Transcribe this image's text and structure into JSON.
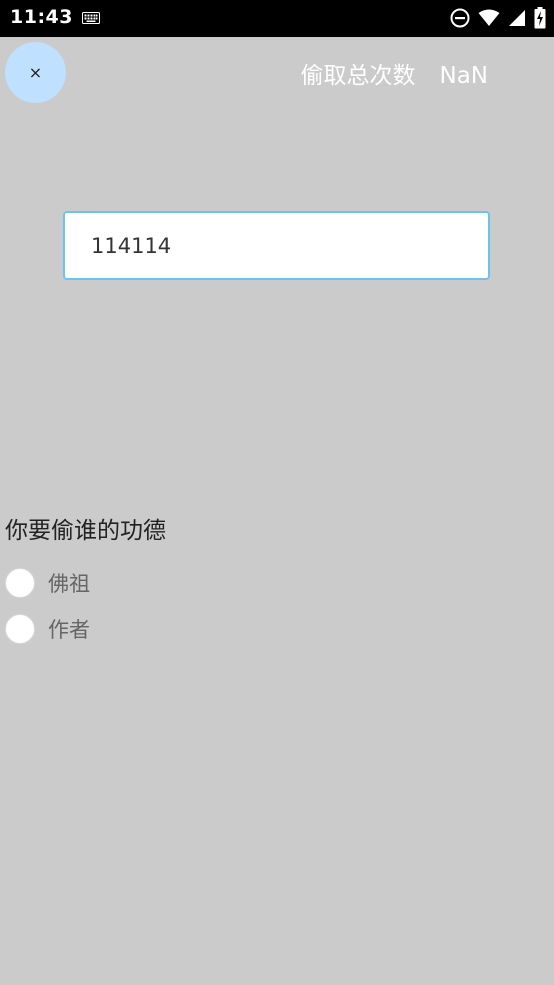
{
  "status_bar": {
    "time": "11:43",
    "icons": [
      "keyboard-icon",
      "do-not-disturb-icon",
      "wifi-icon",
      "signal-icon",
      "battery-charging-icon"
    ]
  },
  "close_button": {
    "label": "×"
  },
  "header": {
    "steal_count_label": "偷取总次数",
    "steal_count_value": "NaN"
  },
  "input": {
    "value": "114114",
    "border_color": "#6ec3ee"
  },
  "question": {
    "title": "你要偷谁的功德",
    "options": [
      {
        "label": "佛祖",
        "selected": false
      },
      {
        "label": "作者",
        "selected": false
      }
    ]
  },
  "colors": {
    "background": "#cbcbcb",
    "fab": "#bfe0ff",
    "status_bar": "#000000"
  }
}
